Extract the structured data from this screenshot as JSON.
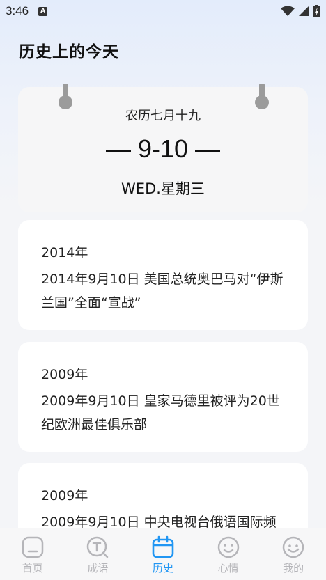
{
  "status_bar": {
    "time": "3:46",
    "a_icon_glyph": "A"
  },
  "page_title": "历史上的今天",
  "calendar": {
    "lunar_date": "农历七月十九",
    "solar_date": "— 9-10 —",
    "weekday": "WED.星期三"
  },
  "events": [
    {
      "year": "2014年",
      "text": "2014年9月10日 美国总统奥巴马对“伊斯兰国”全面“宣战”"
    },
    {
      "year": "2009年",
      "text": "2009年9月10日 皇家马德里被评为20世纪欧洲最佳俱乐部"
    },
    {
      "year": "2009年",
      "text": "2009年9月10日 中央电视台俄语国际频"
    }
  ],
  "nav": {
    "items": [
      {
        "label": "首页",
        "icon": "home-icon"
      },
      {
        "label": "成语",
        "icon": "idiom-icon"
      },
      {
        "label": "历史",
        "icon": "calendar-icon"
      },
      {
        "label": "心情",
        "icon": "smile-icon"
      },
      {
        "label": "我的",
        "icon": "profile-icon"
      }
    ],
    "active_color": "#2196f3",
    "inactive_color": "#b5b5b9"
  }
}
